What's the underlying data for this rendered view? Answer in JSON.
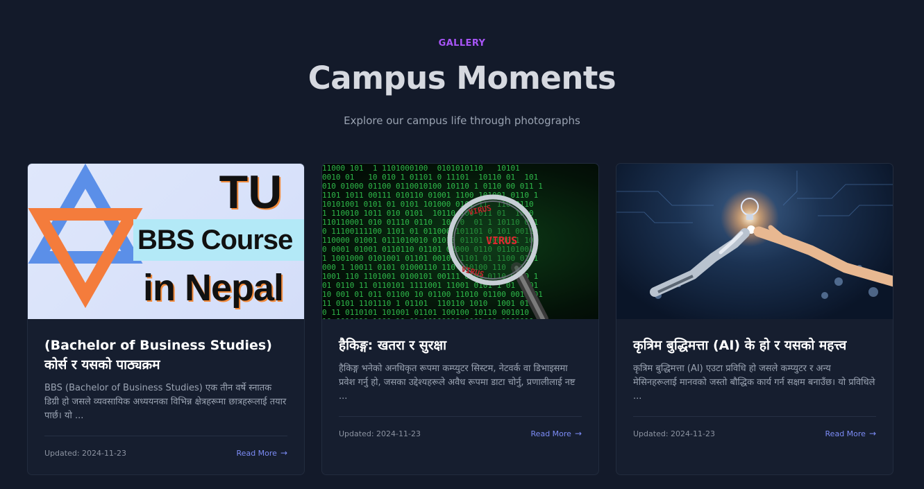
{
  "section": {
    "eyebrow": "GALLERY",
    "title": "Campus Moments",
    "subtitle": "Explore our campus life through photographs"
  },
  "cards": [
    {
      "title": "(Bachelor of Business Studies) कोर्स र यसको पाठ्यक्रम",
      "excerpt": "BBS (Bachelor of Business Studies) एक तीन वर्षे स्नातक डिग्री हो जसले व्यवसायिक अध्ययनका विभिन्न क्षेत्रहरूमा छात्रहरूलाई तयार पार्छ। यो ...",
      "date": "Updated: 2024-11-23",
      "read_more": "Read More",
      "image_text": {
        "line1": "TU",
        "line2": "BBS Course",
        "line3": "in Nepal"
      }
    },
    {
      "title": "हैकिङ्ग: खतरा र सुरक्षा",
      "excerpt": "हैकिङ्ग भनेको अनधिकृत रूपमा कम्प्युटर सिस्टम, नेटवर्क वा डिभाइसमा प्रवेश गर्नु हो, जसका उद्देश्यहरूले अवैध रूपमा डाटा चोर्नु, प्रणालीलाई नष्ट ...",
      "date": "Updated: 2024-11-23",
      "read_more": "Read More",
      "image_text": {
        "virus": "VIRUS"
      }
    },
    {
      "title": "कृत्रिम बुद्धिमत्ता (AI) के हो र यसको महत्त्व",
      "excerpt": "कृत्रिम बुद्धिमत्ता (AI) एउटा प्रविधि हो जसले कम्प्युटर र अन्य मेसिनहरूलाई मानवको जस्तो बौद्धिक कार्य गर्न सक्षम बनाउँछ। यो प्रविधिले ...",
      "date": "Updated: 2024-11-23",
      "read_more": "Read More"
    }
  ],
  "colors": {
    "background": "#131a2a",
    "card": "#161e2f",
    "accent_purple": "#a855f7",
    "link": "#7c8cf6"
  }
}
